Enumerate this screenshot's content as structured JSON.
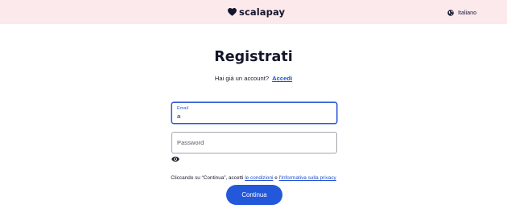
{
  "header": {
    "logo_text": "scalapay",
    "language_label": "Italiano",
    "icons": {
      "logo": "heart-icon",
      "language": "globe-icon"
    }
  },
  "page": {
    "title": "Registrati",
    "login_prompt": "Hai già un account?",
    "login_link": "Accedi"
  },
  "form": {
    "email": {
      "label": "Email",
      "value": "a"
    },
    "password": {
      "placeholder": "Password",
      "value": ""
    },
    "show_password_icon": "eye-icon"
  },
  "consent": {
    "prefix": "Cliccando su “Continua”, accetti",
    "terms_link": "le condizioni",
    "conjunction": "e",
    "privacy_link": "l'Informativa sulla privacy"
  },
  "submit_label": "Continua",
  "colors": {
    "header_bg": "#fbe9ec",
    "accent": "#2358db",
    "link": "#1f4fd1",
    "text": "#1b1b2f"
  }
}
